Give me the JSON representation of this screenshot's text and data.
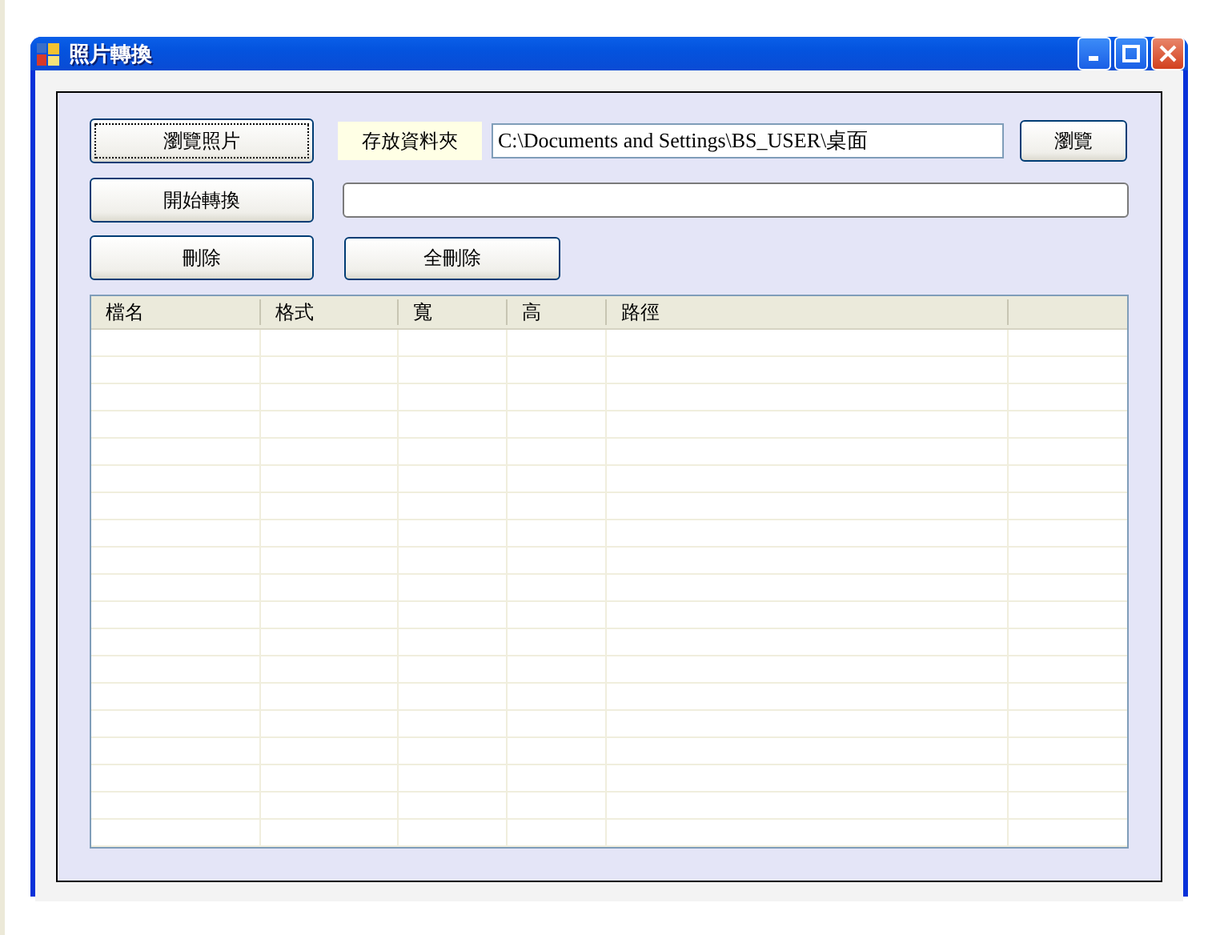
{
  "window": {
    "title": "照片轉換"
  },
  "buttons": {
    "browse_photos": "瀏覽照片",
    "start_convert": "開始轉換",
    "delete": "刪除",
    "delete_all": "全刪除",
    "browse": "瀏覽"
  },
  "save_folder": {
    "label": "存放資料夾",
    "value": "C:\\Documents and Settings\\BS_USER\\桌面"
  },
  "table": {
    "columns": [
      "檔名",
      "格式",
      "寬",
      "高",
      "路徑"
    ]
  }
}
